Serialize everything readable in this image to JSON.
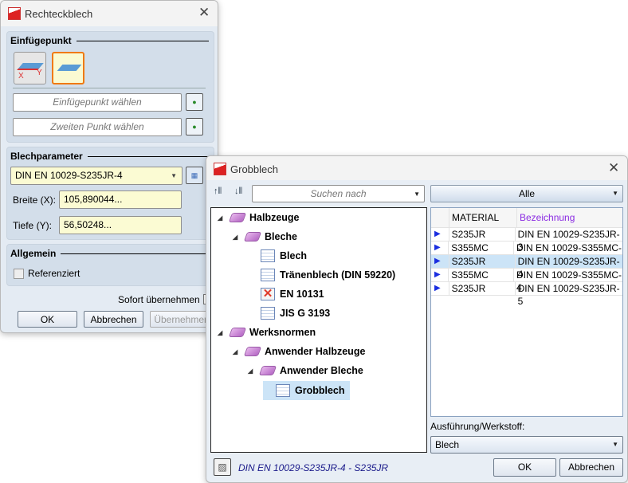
{
  "rechteck": {
    "title": "Rechteckblech",
    "group_insert": "Einfügepunkt",
    "field_insert_placeholder": "Einfügepunkt wählen",
    "field_second_placeholder": "Zweiten Punkt wählen",
    "group_params": "Blechparameter",
    "sheet_select": "DIN EN 10029-S235JR-4",
    "width_label": "Breite (X):",
    "width_value": "105,890044...",
    "depth_label": "Tiefe (Y):",
    "depth_value": "56,50248...",
    "group_general": "Allgemein",
    "referenced_label": "Referenziert",
    "immediate_label": "Sofort übernehmen",
    "ok": "OK",
    "cancel": "Abbrechen",
    "apply": "Übernehmen",
    "axis_x": "X",
    "axis_y": "Y"
  },
  "grobblech": {
    "title": "Grobblech",
    "search_placeholder": "Suchen nach",
    "filter_value": "Alle",
    "tree": [
      {
        "label": "Halbzeuge",
        "icon": "book-icon",
        "level": 0,
        "expanded": true
      },
      {
        "label": "Bleche",
        "icon": "book-icon",
        "level": 1,
        "expanded": true
      },
      {
        "label": "Blech",
        "icon": "table-icon",
        "level": 2
      },
      {
        "label": "Tränenblech (DIN 59220)",
        "icon": "table-icon",
        "level": 2
      },
      {
        "label": "EN 10131",
        "icon": "error-table-icon",
        "level": 2
      },
      {
        "label": "JIS G 3193",
        "icon": "table-icon",
        "level": 2
      },
      {
        "label": "Werksnormen",
        "icon": "book-icon",
        "level": 0,
        "expanded": true
      },
      {
        "label": "Anwender Halbzeuge",
        "icon": "book-icon",
        "level": 1,
        "expanded": true
      },
      {
        "label": "Anwender Bleche",
        "icon": "book-icon",
        "level": 2,
        "expanded": true
      },
      {
        "label": "Grobblech",
        "icon": "table-icon",
        "level": 3,
        "selected": true
      }
    ],
    "columns": [
      "MATERIAL",
      "Bezeichnung"
    ],
    "rows": [
      {
        "material": "S235JR",
        "name": "DIN EN 10029-S235JR-3"
      },
      {
        "material": "S355MC",
        "name": "DIN EN 10029-S355MC-3"
      },
      {
        "material": "S235JR",
        "name": "DIN EN 10029-S235JR-4",
        "selected": true
      },
      {
        "material": "S355MC",
        "name": "DIN EN 10029-S355MC-4"
      },
      {
        "material": "S235JR",
        "name": "DIN EN 10029-S235JR-5"
      }
    ],
    "variant_label": "Ausführung/Werkstoff:",
    "variant_value": "Blech",
    "status": "DIN EN 10029-S235JR-4 - S235JR",
    "ok": "OK",
    "cancel": "Abbrechen",
    "colors": {
      "accent_header": "#8a2be2",
      "selection": "#cce4f7",
      "active_border": "#f07a10"
    }
  }
}
